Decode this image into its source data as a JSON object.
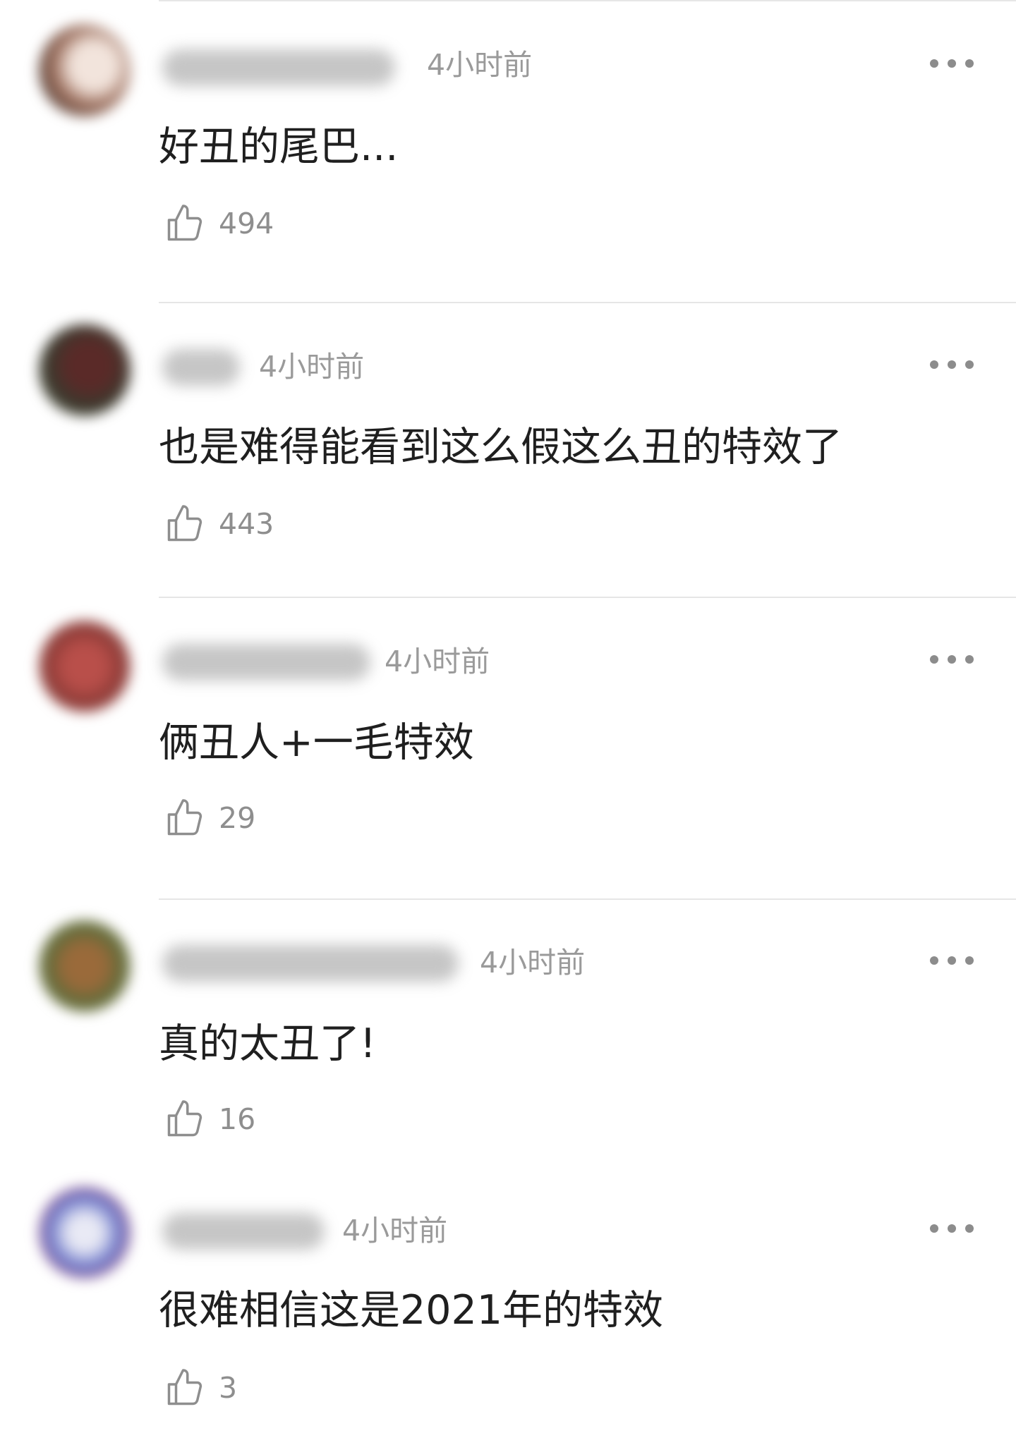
{
  "comments": [
    {
      "time": "4小时前",
      "text": "好丑的尾巴...",
      "likes": "494"
    },
    {
      "time": "4小时前",
      "text": "也是难得能看到这么假这么丑的特效了",
      "likes": "443"
    },
    {
      "time": "4小时前",
      "text": "俩丑人+一毛特效",
      "likes": "29"
    },
    {
      "time": "4小时前",
      "text": "真的太丑了!",
      "likes": "16"
    },
    {
      "time": "4小时前",
      "text": "很难相信这是2021年的特效",
      "likes": "3"
    }
  ],
  "icons": {
    "like": "thumbs-up-icon",
    "more": "more-options-icon",
    "avatar": "avatar"
  },
  "colors": {
    "text": "#1f1f1f",
    "meta": "#9a9a9a",
    "divider": "#e6e6e6"
  }
}
